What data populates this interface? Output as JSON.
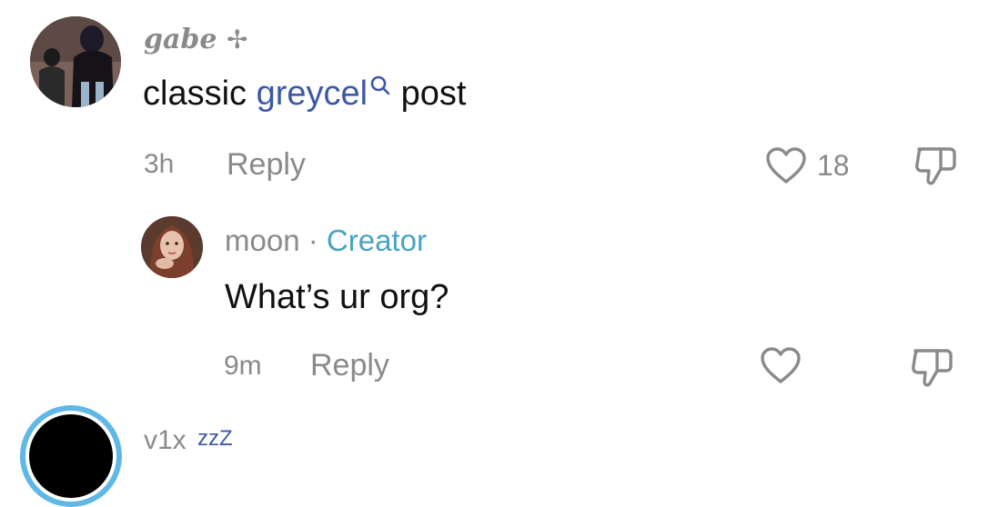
{
  "comments": [
    {
      "username": "gabe",
      "username_suffix": "✢",
      "text_before": "classic ",
      "link_text": "greycel",
      "text_after": " post",
      "time": "3h",
      "reply_label": "Reply",
      "likes": "18"
    },
    {
      "username": "moon",
      "separator": "·",
      "badge": "Creator",
      "text": "What’s ur org?",
      "time": "9m",
      "reply_label": "Reply",
      "likes": ""
    },
    {
      "username": "v1x",
      "status": "zzZ"
    }
  ],
  "colors": {
    "link": "#3d58a8",
    "creator": "#4aa3c4",
    "muted": "#8a8a8a",
    "text": "#111111",
    "ring": "#5fb8e6"
  },
  "icons": [
    "search-icon",
    "heart-icon",
    "dislike-icon"
  ]
}
